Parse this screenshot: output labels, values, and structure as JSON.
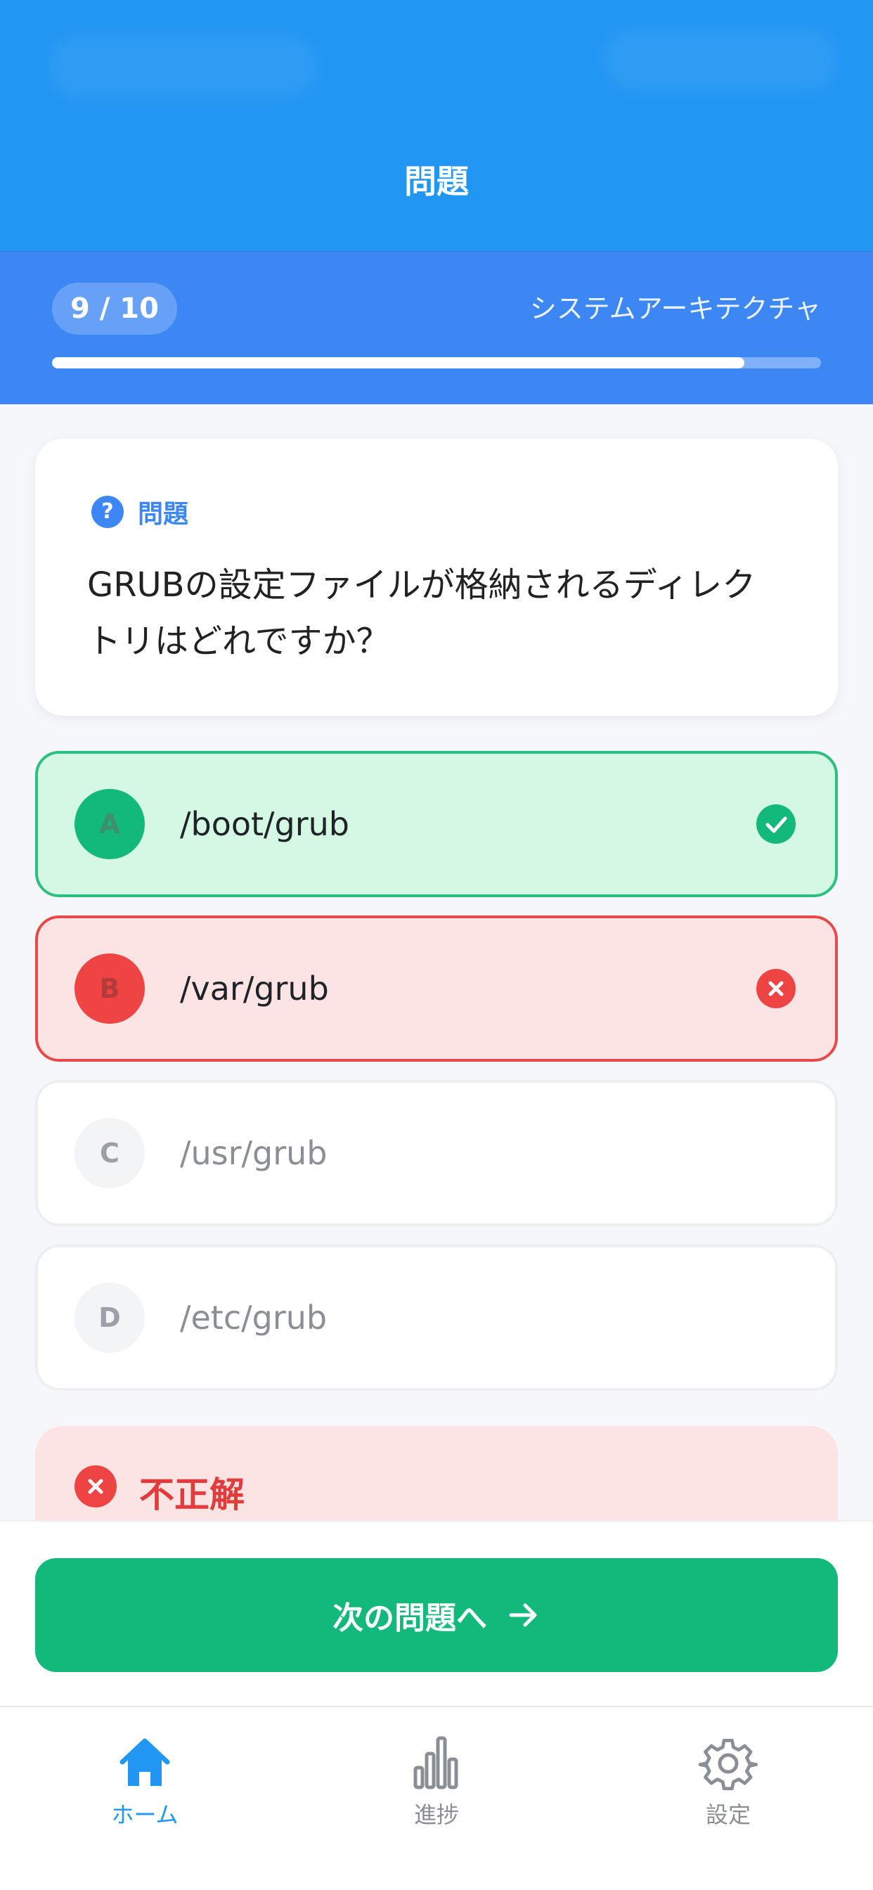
{
  "header": {
    "title": "問題"
  },
  "progress": {
    "counter": "9 / 10",
    "category": "システムアーキテクチャ",
    "fraction": 0.9
  },
  "question": {
    "label": "問題",
    "icon_glyph": "?",
    "line1": "GRUBの設定ファイルが格納されるディレク",
    "line2": "トリはどれですか？"
  },
  "options": [
    {
      "letter": "A",
      "text": "/boot/grub",
      "state": "correct"
    },
    {
      "letter": "B",
      "text": "/var/grub",
      "state": "wrong"
    },
    {
      "letter": "C",
      "text": "/usr/grub",
      "state": "neutral"
    },
    {
      "letter": "D",
      "text": "/etc/grub",
      "state": "neutral"
    }
  ],
  "result": {
    "label": "不正解"
  },
  "actions": {
    "next_label": "次の問題へ"
  },
  "tabs": [
    {
      "label": "ホーム",
      "icon": "home-icon",
      "active": true
    },
    {
      "label": "進捗",
      "icon": "bar-chart-icon",
      "active": false
    },
    {
      "label": "設定",
      "icon": "gear-icon",
      "active": false
    }
  ],
  "colors": {
    "primary": "#2196f3",
    "progress_bg": "#3d87f5",
    "correct": "#13b97a",
    "wrong": "#ef4444"
  }
}
